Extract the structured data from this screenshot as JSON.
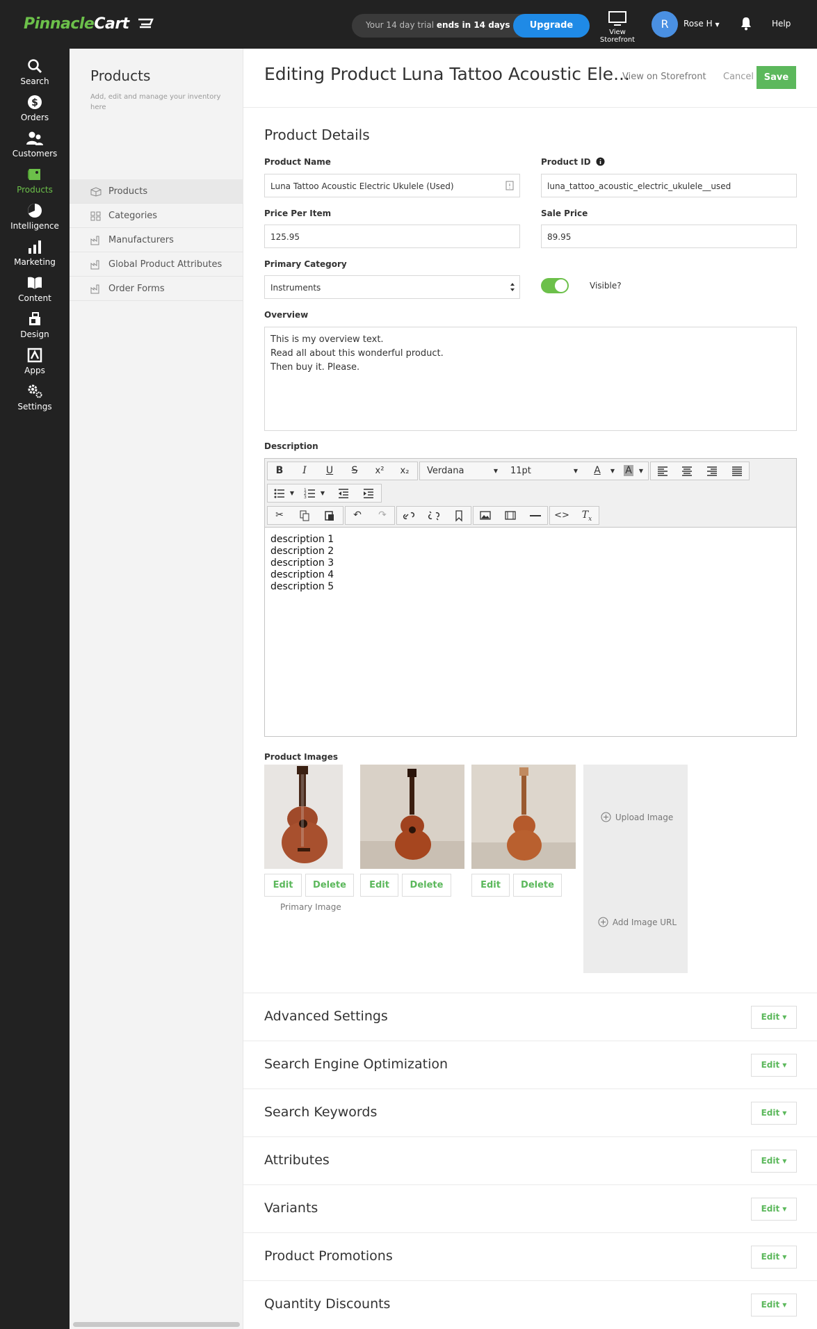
{
  "brand": {
    "logo_first": "Pinnacle",
    "logo_second": "Cart"
  },
  "topbar": {
    "trial_text": "Your 14 day trial",
    "trial_emphasis": "ends in 14 days",
    "upgrade_label": "Upgrade",
    "storefront_label": "View Storefront",
    "avatar_initial": "R",
    "user_name": "Rose H",
    "help_label": "Help"
  },
  "leftnav": {
    "items": [
      {
        "label": "Search"
      },
      {
        "label": "Orders"
      },
      {
        "label": "Customers"
      },
      {
        "label": "Products"
      },
      {
        "label": "Intelligence"
      },
      {
        "label": "Marketing"
      },
      {
        "label": "Content"
      },
      {
        "label": "Design"
      },
      {
        "label": "Apps"
      },
      {
        "label": "Settings"
      }
    ]
  },
  "subnav": {
    "title": "Products",
    "description": "Add, edit and manage your inventory here",
    "items": [
      {
        "label": "Products"
      },
      {
        "label": "Categories"
      },
      {
        "label": "Manufacturers"
      },
      {
        "label": "Global Product Attributes"
      },
      {
        "label": "Order Forms"
      }
    ]
  },
  "header": {
    "title": "Editing Product Luna Tattoo Acoustic Ele...",
    "view_storefront": "View on Storefront",
    "cancel": "Cancel",
    "save": "Save"
  },
  "details": {
    "section_title": "Product Details",
    "product_name_label": "Product Name",
    "product_name_value": "Luna Tattoo Acoustic Electric Ukulele (Used)",
    "product_id_label": "Product ID",
    "product_id_value": "luna_tattoo_acoustic_electric_ukulele__used",
    "price_label": "Price Per Item",
    "price_value": "125.95",
    "sale_label": "Sale Price",
    "sale_value": "89.95",
    "category_label": "Primary Category",
    "category_value": "Instruments",
    "visible_label": "Visible?",
    "overview_label": "Overview",
    "overview_lines": [
      "This is my overview text.",
      "Read all about this wonderful product.",
      "Then buy it. Please."
    ],
    "description_label": "Description"
  },
  "editor": {
    "font_family": "Verdana",
    "font_size": "11pt",
    "body_lines": [
      "description 1",
      "description 2",
      "description 3",
      "description 4",
      "description 5"
    ]
  },
  "images": {
    "label": "Product Images",
    "edit_label": "Edit",
    "delete_label": "Delete",
    "primary_label": "Primary Image",
    "upload_label": "Upload Image",
    "add_url_label": "Add Image URL"
  },
  "accordion": {
    "edit_label": "Edit",
    "sections": [
      {
        "title": "Advanced Settings"
      },
      {
        "title": "Search Engine Optimization"
      },
      {
        "title": "Search Keywords"
      },
      {
        "title": "Attributes"
      },
      {
        "title": "Variants"
      },
      {
        "title": "Product Promotions"
      },
      {
        "title": "Quantity Discounts"
      }
    ]
  },
  "colors": {
    "brand_green": "#6cc04a",
    "save_green": "#5cb85c",
    "upgrade_blue": "#1f8ae6",
    "dark_bg": "#222222"
  }
}
